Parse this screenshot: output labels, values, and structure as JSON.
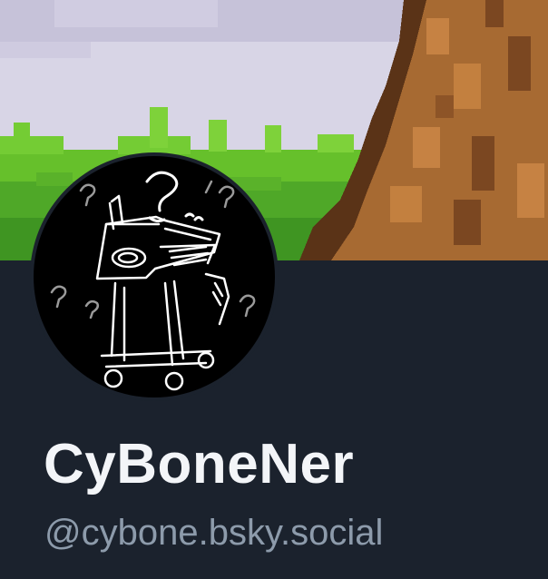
{
  "profile": {
    "display_name": "CyBoneNer",
    "handle": "@cybone.bsky.social"
  },
  "banner": {
    "icon": "pixel-art-landscape-with-tree"
  },
  "avatar": {
    "icon": "sketch-of-confused-robot"
  },
  "colors": {
    "background": "#1b222d",
    "name_text": "#f3f5f8",
    "handle_text": "#8d9bab",
    "sky": "#d9d6e6",
    "grass": "#6cc72e",
    "tree_bark": "#b06f35"
  }
}
